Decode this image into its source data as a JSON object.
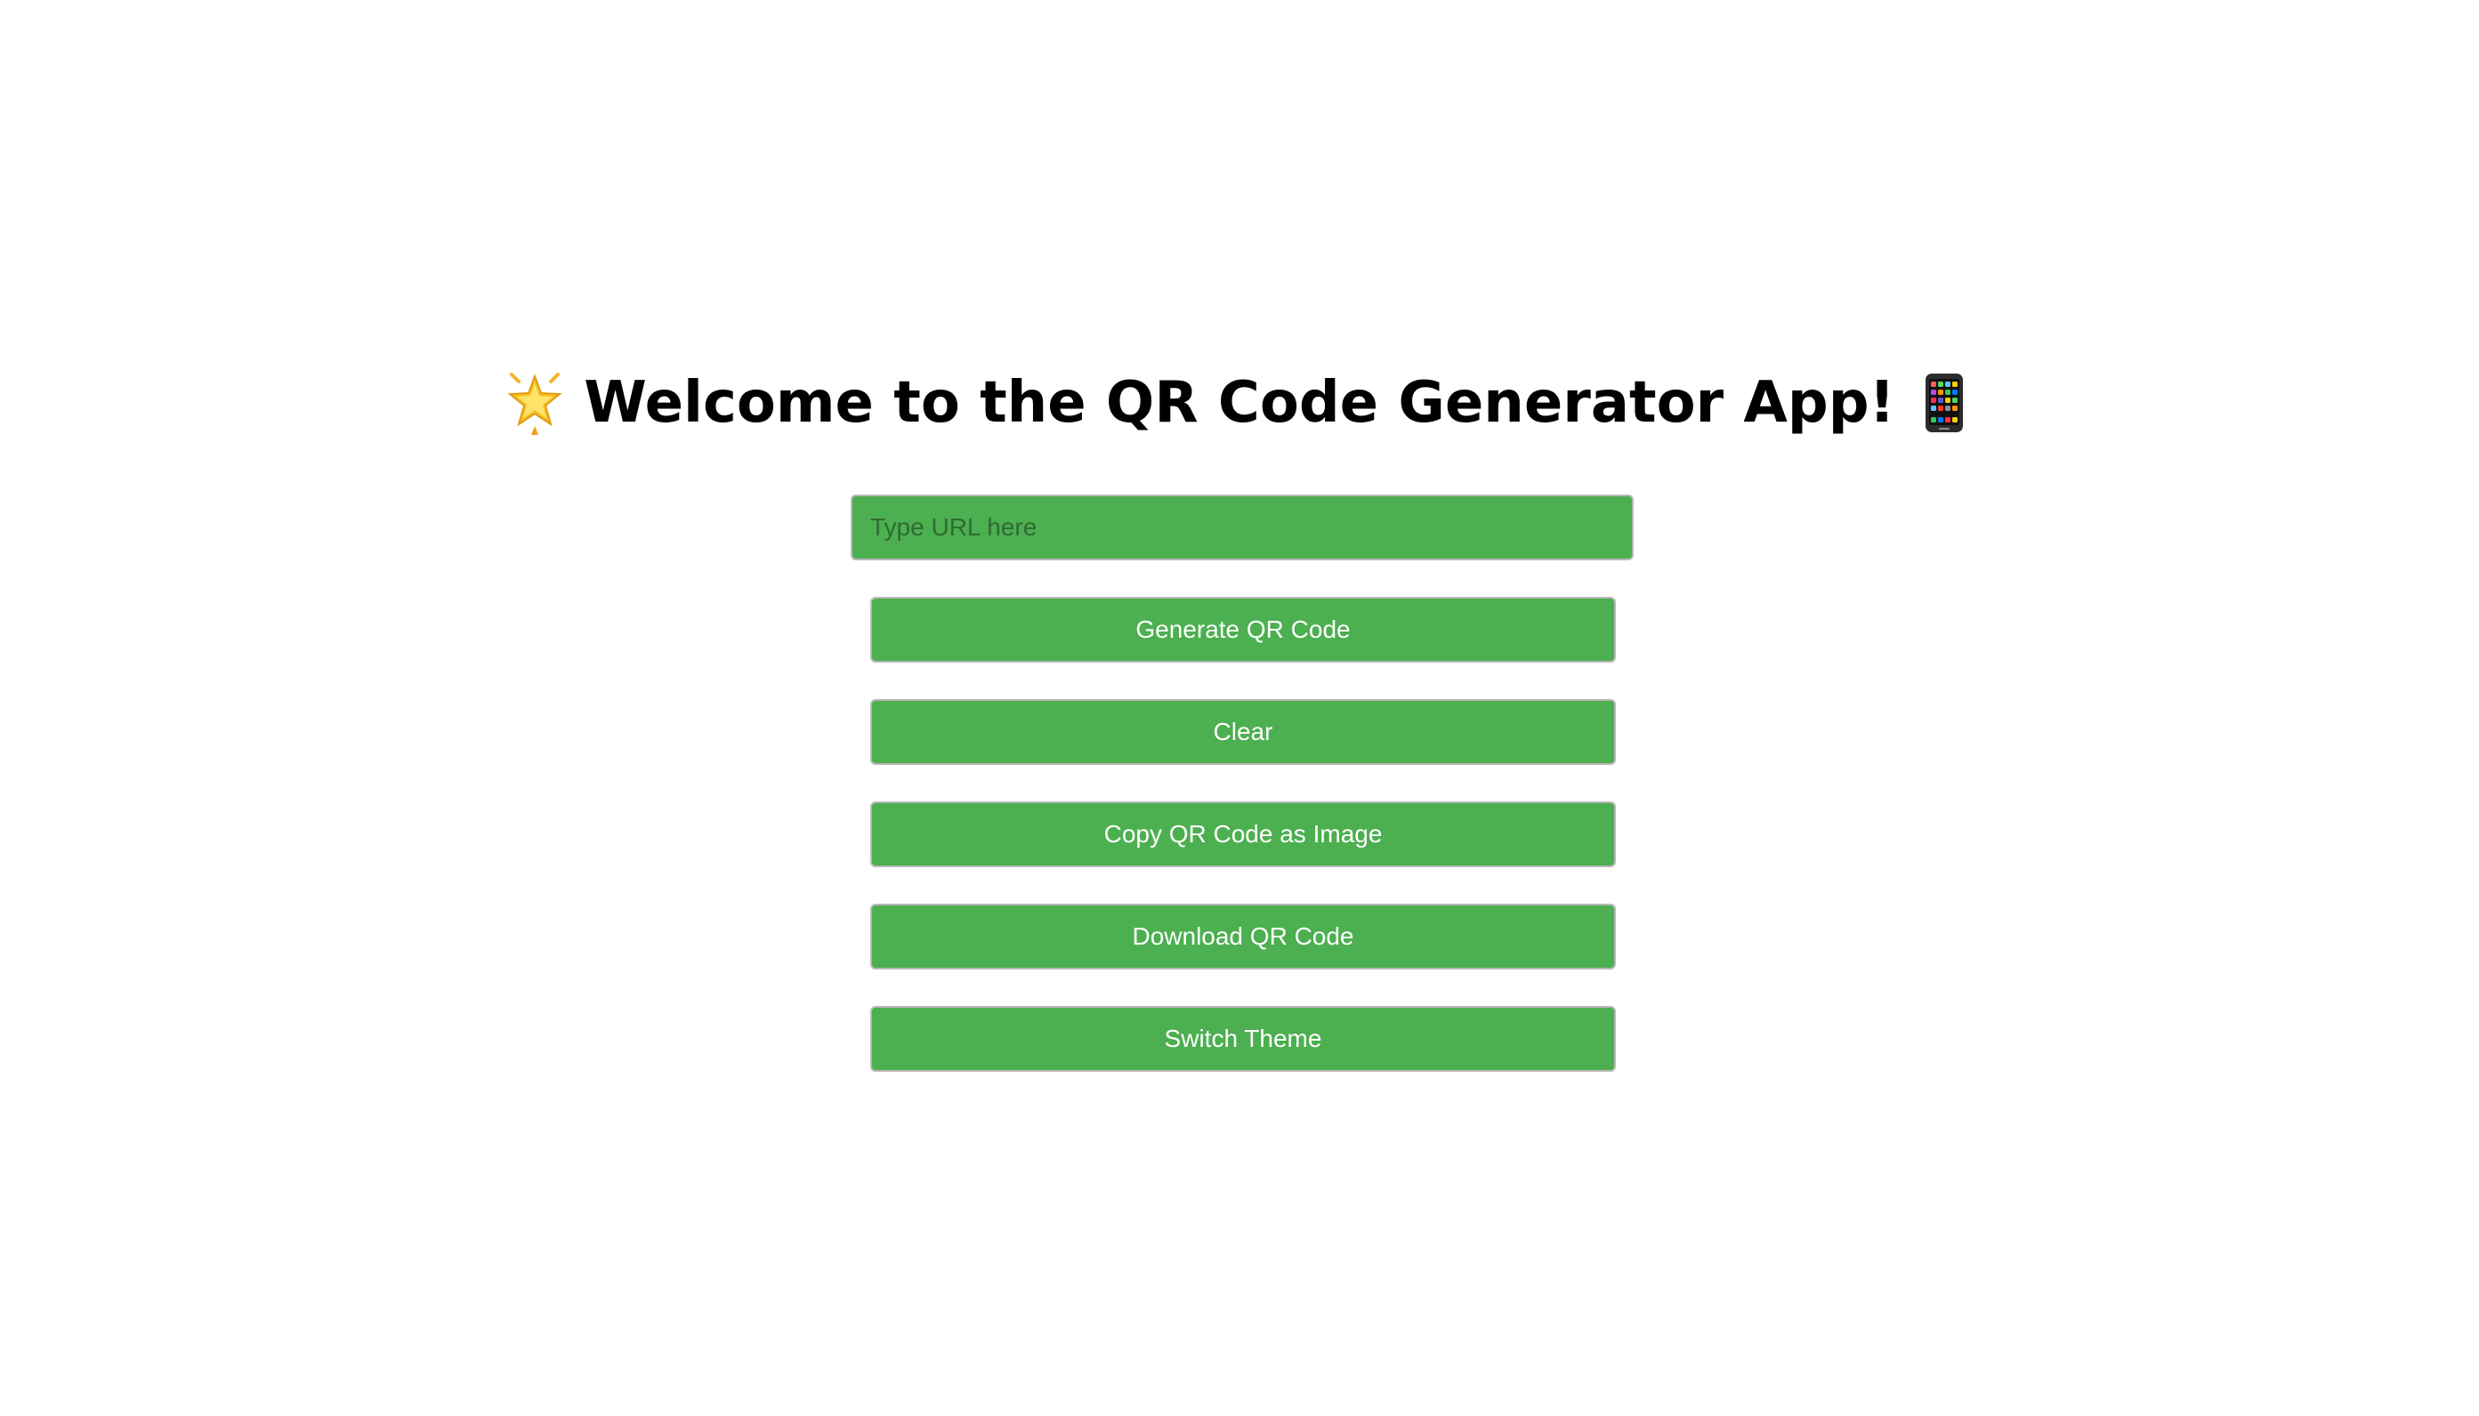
{
  "header": {
    "title": "Welcome to the QR Code Generator App!",
    "leading_icon": "glowing-star-emoji",
    "trailing_icon": "mobile-phone-emoji"
  },
  "form": {
    "url_input": {
      "placeholder": "Type URL here",
      "value": ""
    }
  },
  "buttons": {
    "generate": "Generate QR Code",
    "clear": "Clear",
    "copy_image": "Copy QR Code as Image",
    "download": "Download QR Code",
    "switch_theme": "Switch Theme"
  },
  "colors": {
    "accent": "#4caf50",
    "button_text": "#ffffff",
    "border": "#b9b9b9",
    "title_text": "#000000",
    "background": "#ffffff"
  }
}
